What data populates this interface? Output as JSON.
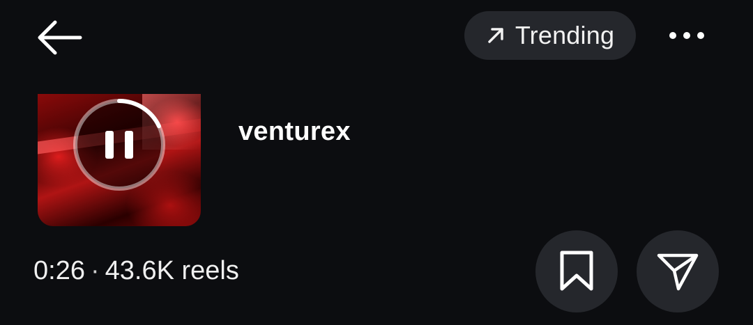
{
  "header": {
    "back_icon": "arrow-left-icon",
    "trending_label": "Trending",
    "trending_icon": "arrow-up-right-icon",
    "more_icon": "more-horizontal-icon"
  },
  "reel": {
    "username": "venturex",
    "duration": "0:26",
    "separator": "·",
    "reels_count": "43.6K reels",
    "playback_progress": 0.18,
    "thumbnail_icon": "pause-icon"
  },
  "actions": {
    "save_icon": "bookmark-icon",
    "share_icon": "send-icon"
  },
  "colors": {
    "background": "#0c0d10",
    "chip_background": "#25272c",
    "text": "#ffffff",
    "thumbnail_accent": "#b01414"
  }
}
